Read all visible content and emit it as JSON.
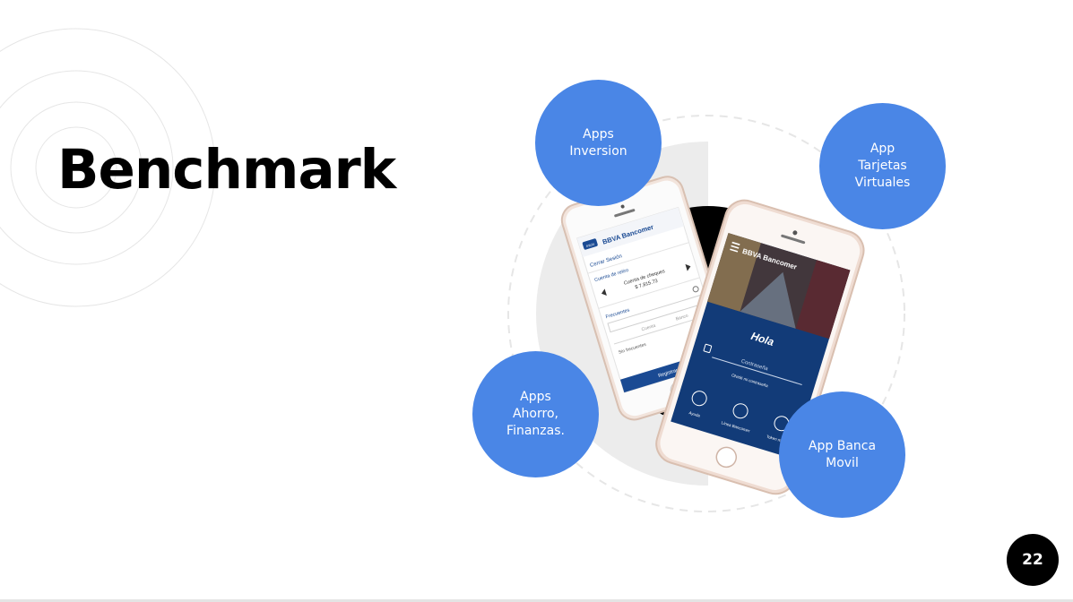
{
  "slide": {
    "title": "Benchmark",
    "page_number": "22"
  },
  "bubbles": {
    "inversion": "Apps\nInversion",
    "tarjetas": "App\nTarjetas\nVirtuales",
    "ahorro": "Apps\nAhorro,\nFinanzas.",
    "banca_movil": "App Banca\nMovil"
  },
  "phone_left": {
    "brand": "BBVA Bancomer",
    "menu_label": "Inicio",
    "nav_item": "Cerrar Sesión",
    "account_label": "Cuenta de retiro",
    "balance_label": "Cuenta de cheques",
    "balance_value": "$ 7,815.73",
    "section_label": "Frecuentes",
    "field_1": "Cuenta",
    "field_2": "Banco",
    "list_item": "Sin frecuentes",
    "button_label": "Registrar cuenta"
  },
  "phone_right": {
    "brand": "BBVA Bancomer",
    "greeting": "Hola",
    "password_placeholder": "Contraseña",
    "forgot_link": "Olvidé mi contraseña",
    "icon_1_label": "Ayuda",
    "icon_2_label": "Línea Bancomer",
    "icon_3_label": "Token móvil"
  },
  "colors": {
    "accent_blue": "#4a86e6",
    "phone_ui_blue": "#1a4a93",
    "black": "#000000"
  }
}
